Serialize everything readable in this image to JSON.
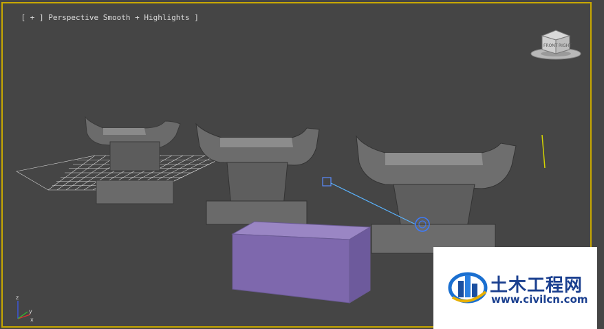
{
  "viewport": {
    "label": "[ + ] Perspective ] Smooth + Highlights ]",
    "label_parts": {
      "plus": "[ + ]",
      "view": "Perspective",
      "shading": "Smooth + Highlights",
      "close": "]"
    },
    "border_color": "#c8a800",
    "background_color": "#454545"
  },
  "viewcube": {
    "face_front": "FRONT",
    "face_right": "RIGHT",
    "icon": "viewcube-icon"
  },
  "axis_tripod": {
    "x_label": "x",
    "y_label": "y",
    "z_label": "z"
  },
  "scene": {
    "objects": [
      {
        "name": "ornament-left",
        "type": "ridge-ornament"
      },
      {
        "name": "ornament-middle",
        "type": "ridge-ornament"
      },
      {
        "name": "ornament-right",
        "type": "ridge-ornament"
      },
      {
        "name": "purple-box",
        "type": "box",
        "color": "#8a72b4"
      },
      {
        "name": "ground-grid",
        "type": "plane"
      },
      {
        "name": "target-light",
        "type": "light"
      }
    ],
    "box_color": "#8a72b4",
    "light_helper_color": "#3d7cff"
  },
  "watermark": {
    "brand_text": "土木工程网",
    "url_text": "www.civilcn.com",
    "brand_color": "#1a3f8f"
  }
}
